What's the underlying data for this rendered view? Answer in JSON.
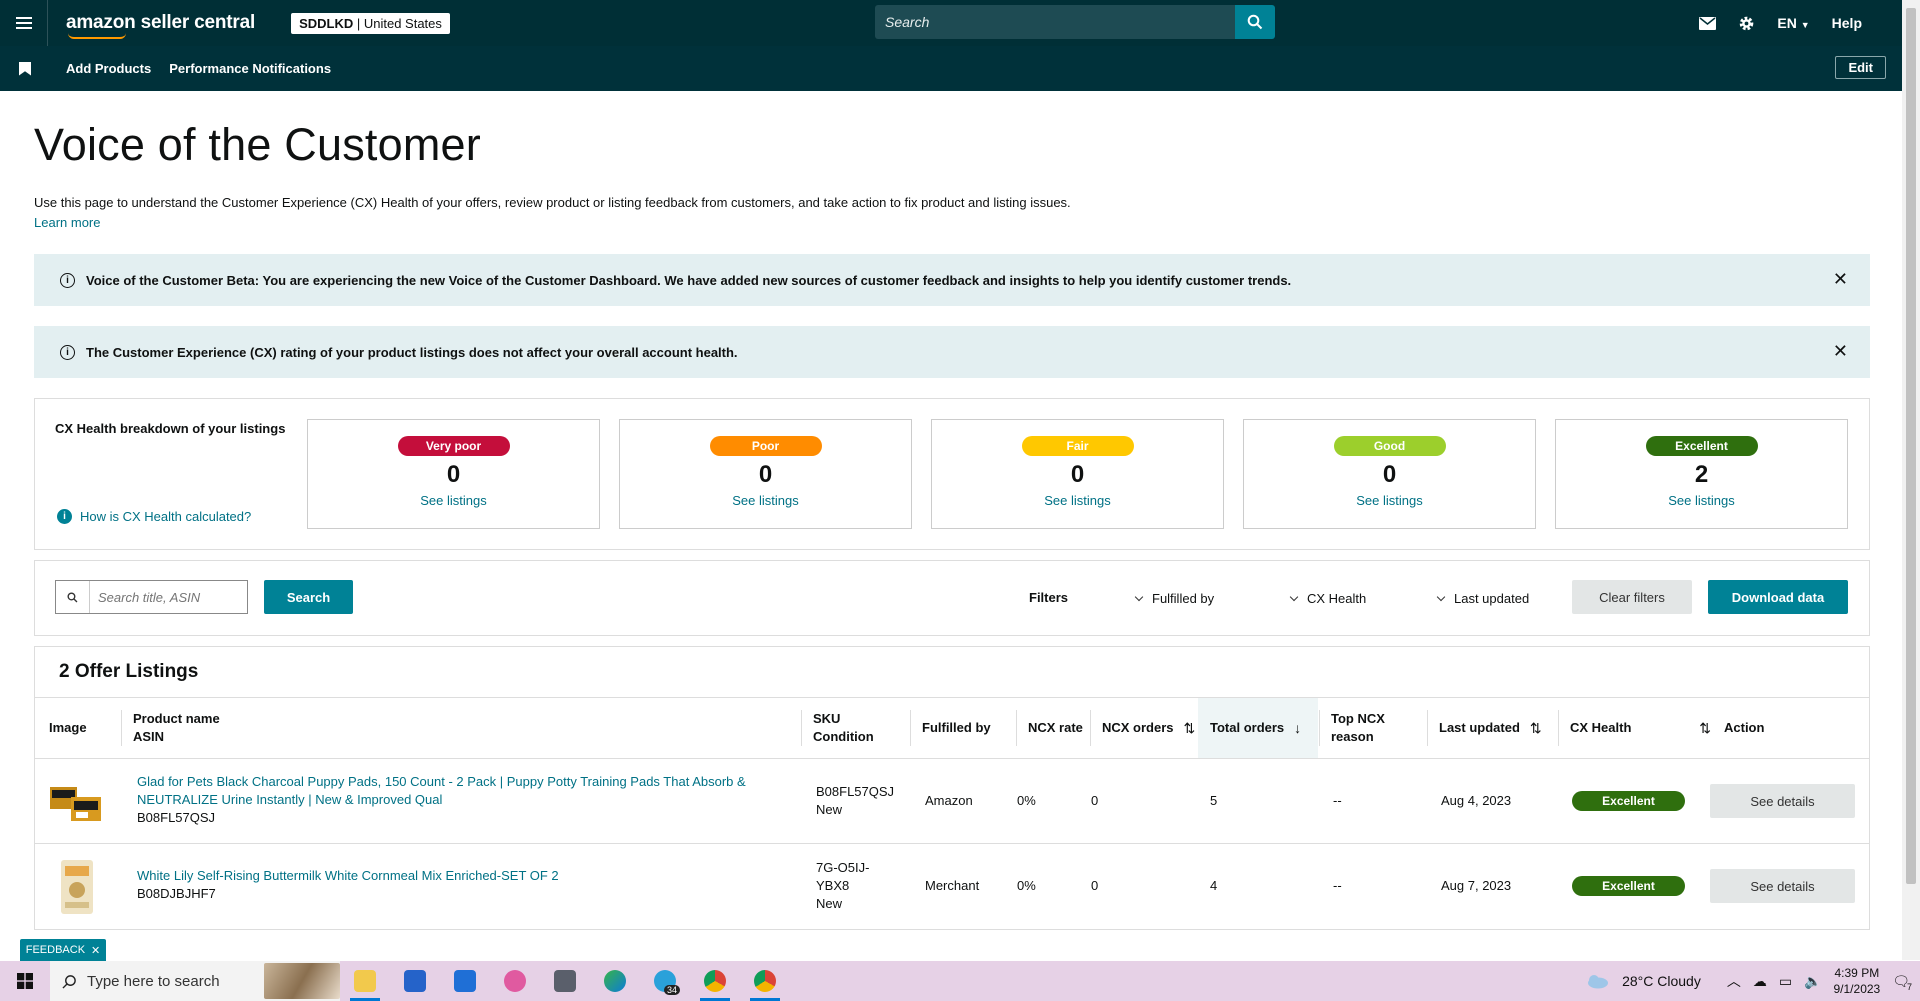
{
  "header": {
    "logo_text": "amazon seller central",
    "store_code": "SDDLKD",
    "store_country": "United States",
    "search_placeholder": "Search",
    "language": "EN",
    "help_label": "Help"
  },
  "subnav": {
    "items": [
      "Add Products",
      "Performance Notifications"
    ],
    "edit_label": "Edit"
  },
  "page": {
    "title": "Voice of the Customer",
    "description": "Use this page to understand the Customer Experience (CX) Health of your offers, review product or listing feedback from customers, and take action to fix product and listing issues.",
    "learn_more": "Learn more"
  },
  "alerts": [
    {
      "text": "Voice of the Customer Beta: You are experiencing the new Voice of the Customer Dashboard. We have added new sources of customer feedback and insights to help you identify customer trends."
    },
    {
      "text": "The Customer Experience (CX) rating of your product listings does not affect your overall account health."
    }
  ],
  "cx_health": {
    "label": "CX Health breakdown of your listings",
    "how_link": "How is CX Health calculated?",
    "cards": [
      {
        "label": "Very poor",
        "count": "0",
        "link": "See listings",
        "color": "#c40e3b"
      },
      {
        "label": "Poor",
        "count": "0",
        "link": "See listings",
        "color": "#ff8c00"
      },
      {
        "label": "Fair",
        "count": "0",
        "link": "See listings",
        "color": "#ffc800"
      },
      {
        "label": "Good",
        "count": "0",
        "link": "See listings",
        "color": "#9ccf2c"
      },
      {
        "label": "Excellent",
        "count": "2",
        "link": "See listings",
        "color": "#2f6f0e"
      }
    ]
  },
  "filters": {
    "search_placeholder": "Search title, ASIN",
    "search_button": "Search",
    "filters_label": "Filters",
    "fulfilled_by": "Fulfilled by",
    "cx_health": "CX Health",
    "last_updated": "Last updated",
    "clear_button": "Clear filters",
    "download_button": "Download data"
  },
  "listings": {
    "title": "2 Offer Listings",
    "headers": {
      "image": "Image",
      "product_name": "Product name",
      "asin": "ASIN",
      "sku": "SKU",
      "condition": "Condition",
      "fulfilled_by": "Fulfilled by",
      "ncx_rate": "NCX rate",
      "ncx_orders": "NCX orders",
      "total_orders": "Total orders",
      "top_ncx_reason_1": "Top NCX",
      "top_ncx_reason_2": "reason",
      "last_updated": "Last updated",
      "cx_health": "CX Health",
      "action": "Action"
    },
    "rows": [
      {
        "product_name_1": "Glad for Pets Black Charcoal Puppy Pads, 150 Count - 2 Pack | Puppy Potty Training Pads That Absorb &",
        "product_name_2": "NEUTRALIZE Urine Instantly | New & Improved Qual",
        "asin": "B08FL57QSJ",
        "sku_1": "B08FL57QSJ",
        "sku_2": "",
        "condition": "New",
        "fulfilled_by": "Amazon",
        "ncx_rate": "0%",
        "ncx_orders": "0",
        "total_orders": "5",
        "top_ncx_reason": "--",
        "last_updated": "Aug 4, 2023",
        "cx_health": "Excellent",
        "action": "See details"
      },
      {
        "product_name_1": "White Lily Self-Rising Buttermilk White Cornmeal Mix Enriched-SET OF 2",
        "product_name_2": "",
        "asin": "B08DJBJHF7",
        "sku_1": "7G-O5IJ-",
        "sku_2": "YBX8",
        "condition": "New",
        "fulfilled_by": "Merchant",
        "ncx_rate": "0%",
        "ncx_orders": "0",
        "total_orders": "4",
        "top_ncx_reason": "--",
        "last_updated": "Aug 7, 2023",
        "cx_health": "Excellent",
        "action": "See details"
      }
    ]
  },
  "feedback_tab": "FEEDBACK",
  "taskbar": {
    "search_placeholder": "Type here to search",
    "weather": "28°C  Cloudy",
    "time": "4:39 PM",
    "date": "9/1/2023",
    "telegram_badge": "34",
    "notification_count": "7"
  }
}
